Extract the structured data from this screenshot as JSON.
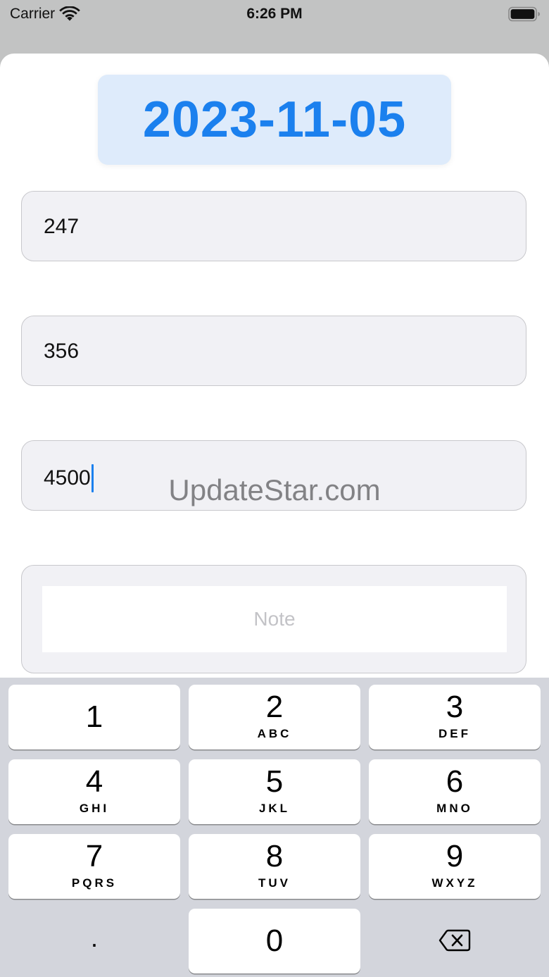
{
  "status_bar": {
    "carrier": "Carrier",
    "time": "6:26 PM"
  },
  "date_badge": {
    "date": "2023-11-05",
    "text_color": "#1b80ee",
    "background": "#deebfb"
  },
  "fields": [
    {
      "value": "247"
    },
    {
      "value": "356"
    },
    {
      "value": "4500",
      "focused": true
    }
  ],
  "note": {
    "placeholder": "Note"
  },
  "watermark": "UpdateStar.com",
  "keypad": {
    "keys": [
      {
        "digit": "1",
        "letters": ""
      },
      {
        "digit": "2",
        "letters": "ABC"
      },
      {
        "digit": "3",
        "letters": "DEF"
      },
      {
        "digit": "4",
        "letters": "GHI"
      },
      {
        "digit": "5",
        "letters": "JKL"
      },
      {
        "digit": "6",
        "letters": "MNO"
      },
      {
        "digit": "7",
        "letters": "PQRS"
      },
      {
        "digit": "8",
        "letters": "TUV"
      },
      {
        "digit": "9",
        "letters": "WXYZ"
      },
      {
        "digit": "0",
        "letters": ""
      }
    ],
    "decimal": ".",
    "delete_icon": "delete-backspace-icon"
  },
  "icons": {
    "wifi": "wifi-icon",
    "battery": "battery-icon"
  }
}
